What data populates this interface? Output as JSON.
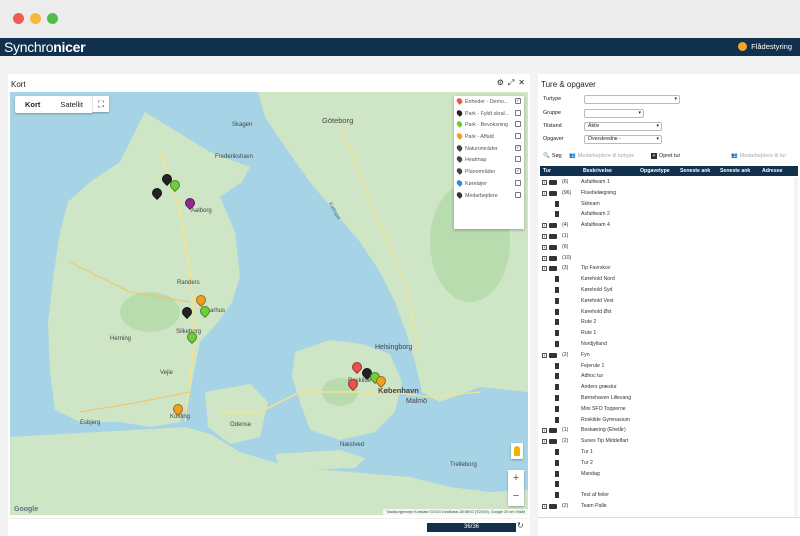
{
  "window": {
    "dots": [
      "#ee5b52",
      "#f5b83d",
      "#4fbd4a"
    ]
  },
  "app": {
    "logo_normal": "Synchro",
    "logo_bold": "nicer",
    "fleet_label": "Flådestyring"
  },
  "map_panel": {
    "title": "Kort",
    "map_types": [
      "Kort",
      "Satellit"
    ],
    "legend": [
      {
        "label": "Enheder - Demo...",
        "icon_color": "#e8534a",
        "checked": true
      },
      {
        "label": "Park - Fyldt skral...",
        "icon_color": "#222222",
        "checked": false
      },
      {
        "label": "Park - Bevoksning",
        "icon_color": "#6fcf3b",
        "checked": false
      },
      {
        "label": "Park - Affald",
        "icon_color": "#f0a020",
        "checked": false
      },
      {
        "label": "Naturområder",
        "icon_color": "#444444",
        "checked": true
      },
      {
        "label": "Heatmap",
        "icon_color": "#444444",
        "checked": false
      },
      {
        "label": "Planområder",
        "icon_color": "#444444",
        "checked": true
      },
      {
        "label": "Køretøjer",
        "icon_color": "#2b89d6",
        "checked": false
      },
      {
        "label": "Medarbejdere",
        "icon_color": "#333333",
        "checked": false
      }
    ],
    "cities": [
      "Skagen",
      "Frederikshavn",
      "Göteborg",
      "Aalborg",
      "Aarhus",
      "Randers",
      "Silkeborg",
      "Esbjerg",
      "Kolding",
      "Odense",
      "Helsingborg",
      "København",
      "Malmö",
      "Roskilde",
      "Herning",
      "Vejle",
      "Næstved",
      "Trelleborg"
    ],
    "sea_labels": [
      "Kattegat"
    ],
    "attribution": "Tastaturgenveje  Kortdata ©2024 GeoBasis-DE/BKG (©2009), Google   20 km   Vilkår",
    "google_logo": "Google",
    "counter": "36/36"
  },
  "right_panel": {
    "title": "Ture & opgaver",
    "filters": {
      "turtype": {
        "label": "Turtype",
        "value": ""
      },
      "gruppe": {
        "label": "Gruppe",
        "value": ""
      },
      "tilstand": {
        "label": "Tilstand",
        "value": "Aktiv"
      },
      "opgaver": {
        "label": "Opgaver",
        "value": "Overskredne -"
      }
    },
    "buttons": {
      "search": "Søg",
      "assign_tour_type": "Medarbejdere til turtype",
      "create_tour": "Opret tur",
      "assign_tour": "Medarbejdere til tur"
    },
    "columns": [
      "Tur",
      "Beskrivelse",
      "Opgavetype",
      "Seneste ank",
      "Seneste ank",
      "Adresse"
    ],
    "rows": [
      {
        "type": "folder",
        "count": "(6)",
        "desc": "Asfaltteam 1"
      },
      {
        "type": "folder",
        "count": "(96)",
        "desc": "Flisebelægning"
      },
      {
        "type": "doc",
        "count": "",
        "desc": "Skiteam"
      },
      {
        "type": "doc",
        "count": "",
        "desc": "Asfaltteam 2"
      },
      {
        "type": "folder",
        "count": "(4)",
        "desc": "Asfaltteam 4"
      },
      {
        "type": "folder",
        "count": "(1)",
        "desc": ""
      },
      {
        "type": "folder",
        "count": "(6)",
        "desc": ""
      },
      {
        "type": "folder",
        "count": "(10)",
        "desc": ""
      },
      {
        "type": "folder",
        "count": "(3)",
        "desc": "Tip Favrskov"
      },
      {
        "type": "doc",
        "count": "",
        "desc": "Kørehold Nord"
      },
      {
        "type": "doc",
        "count": "",
        "desc": "Kørehold Syd"
      },
      {
        "type": "doc",
        "count": "",
        "desc": "Kørehold Vest"
      },
      {
        "type": "doc",
        "count": "",
        "desc": "Kørehold Øst"
      },
      {
        "type": "doc",
        "count": "",
        "desc": "Rute 2"
      },
      {
        "type": "doc",
        "count": "",
        "desc": "Rute 1"
      },
      {
        "type": "doc",
        "count": "",
        "desc": "Nordjylland"
      },
      {
        "type": "folder",
        "count": "(2)",
        "desc": "Fyn"
      },
      {
        "type": "doc",
        "count": "",
        "desc": "Fejerute 1"
      },
      {
        "type": "doc",
        "count": "",
        "desc": "Adhoc tur"
      },
      {
        "type": "doc",
        "count": "",
        "desc": "Anders græstur"
      },
      {
        "type": "doc",
        "count": "",
        "desc": "Børnehaven Lillevang"
      },
      {
        "type": "doc",
        "count": "",
        "desc": "Mini SFO Topperne"
      },
      {
        "type": "doc",
        "count": "",
        "desc": "Roskilde Gymnasium"
      },
      {
        "type": "folder",
        "count": "(1)",
        "desc": "Beskæring (Ehelår)"
      },
      {
        "type": "folder",
        "count": "(2)",
        "desc": "Sunes Tip Middelfart"
      },
      {
        "type": "doc",
        "count": "",
        "desc": "Tur 1"
      },
      {
        "type": "doc",
        "count": "",
        "desc": "Tur 2"
      },
      {
        "type": "doc",
        "count": "",
        "desc": "Mandag"
      },
      {
        "type": "doc",
        "count": "",
        "desc": ""
      },
      {
        "type": "doc",
        "count": "",
        "desc": "Test af feiler"
      },
      {
        "type": "folder",
        "count": "(2)",
        "desc": "Team Palle"
      }
    ]
  }
}
